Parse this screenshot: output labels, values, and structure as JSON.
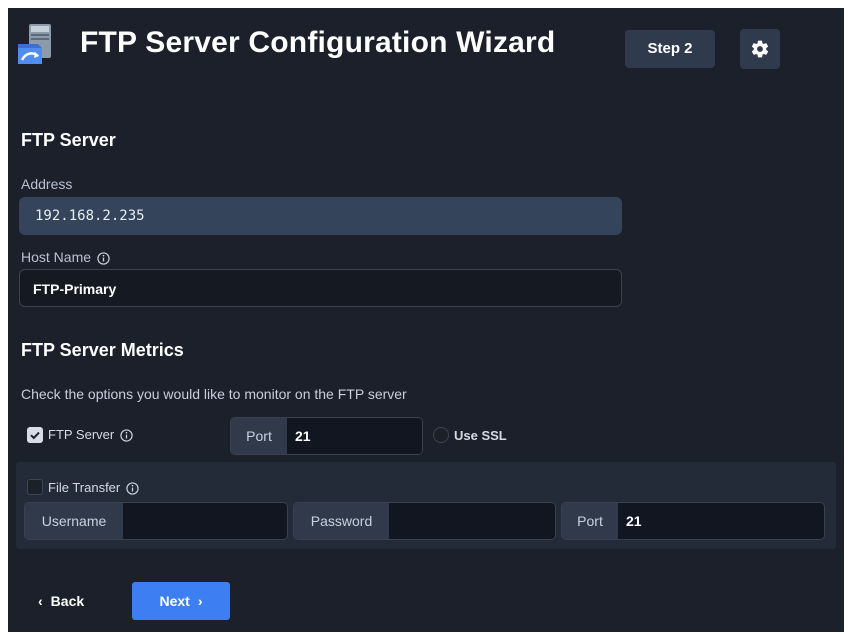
{
  "header": {
    "app_icon": "ftp-server-icon",
    "title": "FTP Server Configuration Wizard",
    "step_label": "Step 2",
    "settings_icon": "gear-icon"
  },
  "server": {
    "section_title": "FTP Server",
    "address_label": "Address",
    "address_value": "192.168.2.235",
    "host_label": "Host Name",
    "host_value": "FTP-Primary"
  },
  "metrics": {
    "section_title": "FTP Server Metrics",
    "description": "Check the options you would like to monitor on the FTP server",
    "ftp_server": {
      "label": "FTP Server",
      "checked": true,
      "port_label": "Port",
      "port_value": "21",
      "use_ssl_label": "Use SSL",
      "use_ssl_checked": false
    },
    "file_transfer": {
      "label": "File Transfer",
      "checked": false,
      "username_label": "Username",
      "username_value": "",
      "password_label": "Password",
      "password_value": "",
      "port_label": "Port",
      "port_value": "21"
    }
  },
  "footer": {
    "back_label": "Back",
    "next_label": "Next"
  },
  "colors": {
    "background": "#1c202b",
    "accent": "#3d7ff3",
    "field_filled": "#34445a",
    "field_empty": "#121620"
  }
}
